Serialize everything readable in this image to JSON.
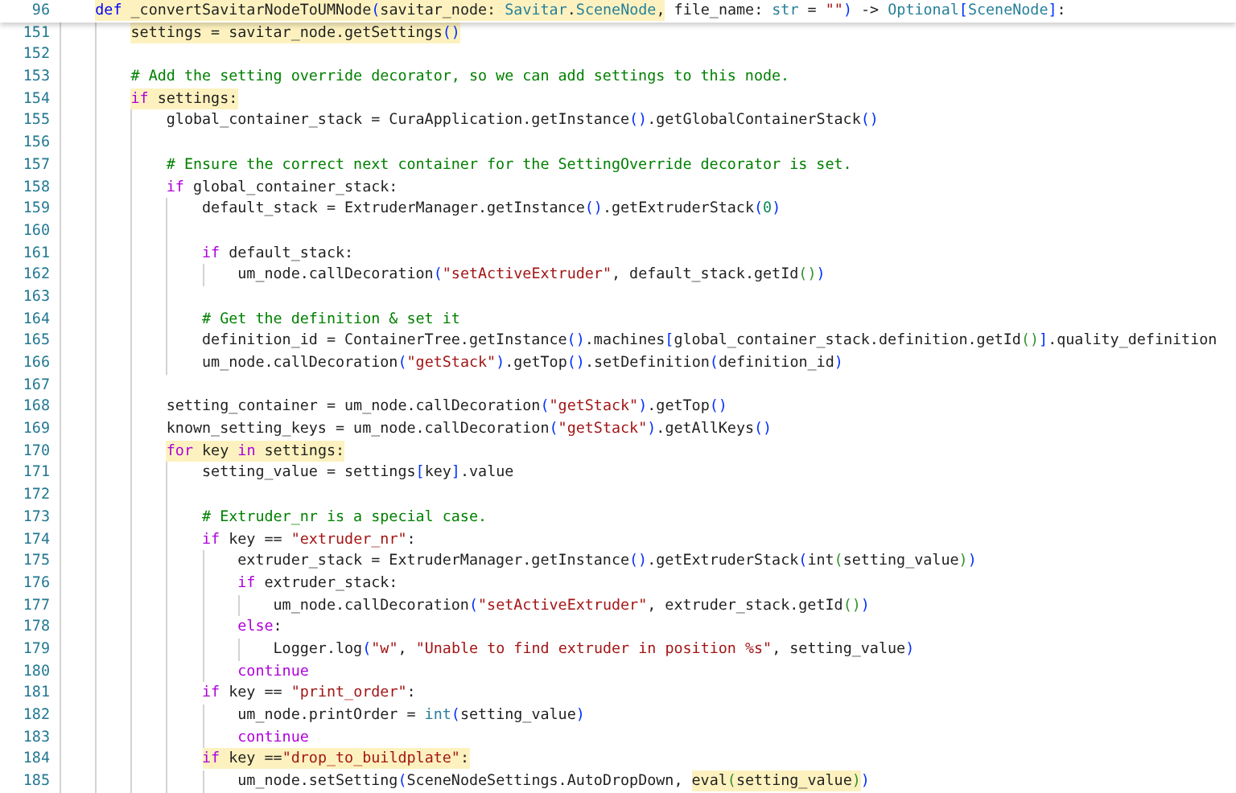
{
  "sticky_line": {
    "number": "96",
    "segments": [
      {
        "highlighted": true,
        "tokens": [
          {
            "kind": "keyword",
            "text": "def"
          },
          {
            "kind": "plain",
            "text": " _convertSavitarNodeToUMNode"
          },
          {
            "kind": "bracket",
            "text": "("
          },
          {
            "kind": "plain",
            "text": "savitar_node: "
          },
          {
            "kind": "type",
            "text": "Savitar"
          },
          {
            "kind": "plain",
            "text": "."
          },
          {
            "kind": "type",
            "text": "SceneNode"
          },
          {
            "kind": "plain",
            "text": ","
          }
        ]
      },
      {
        "highlighted": false,
        "tokens": [
          {
            "kind": "plain",
            "text": " file_name: "
          },
          {
            "kind": "type",
            "text": "str"
          },
          {
            "kind": "plain",
            "text": " = "
          },
          {
            "kind": "string",
            "text": "\"\""
          },
          {
            "kind": "bracket",
            "text": ")"
          },
          {
            "kind": "plain",
            "text": " -> "
          },
          {
            "kind": "type",
            "text": "Optional"
          },
          {
            "kind": "bracket",
            "text": "["
          },
          {
            "kind": "type",
            "text": "SceneNode"
          },
          {
            "kind": "bracket",
            "text": "]"
          },
          {
            "kind": "plain",
            "text": ":"
          }
        ]
      }
    ]
  },
  "lines": [
    {
      "number": "151",
      "segments": [
        {
          "highlighted": true,
          "tokens": [
            {
              "kind": "plain",
              "text": "settings = savitar_node.getSettings"
            },
            {
              "kind": "bracket",
              "text": "()"
            }
          ]
        }
      ]
    },
    {
      "number": "152"
    },
    {
      "number": "153",
      "segments": [
        {
          "highlighted": false,
          "tokens": [
            {
              "kind": "comment",
              "text": "# Add the setting override decorator, so we can add settings to this node."
            }
          ]
        }
      ]
    },
    {
      "number": "154",
      "segments": [
        {
          "highlighted": true,
          "tokens": [
            {
              "kind": "control",
              "text": "if"
            },
            {
              "kind": "plain",
              "text": " settings:"
            }
          ]
        }
      ],
      "children": [
        {
          "number": "155",
          "segments": [
            {
              "highlighted": false,
              "tokens": [
                {
                  "kind": "plain",
                  "text": "global_container_stack = CuraApplication.getInstance"
                },
                {
                  "kind": "bracket",
                  "text": "()"
                },
                {
                  "kind": "plain",
                  "text": ".getGlobalContainerStack"
                },
                {
                  "kind": "bracket",
                  "text": "()"
                }
              ]
            }
          ]
        },
        {
          "number": "156"
        },
        {
          "number": "157",
          "segments": [
            {
              "highlighted": false,
              "tokens": [
                {
                  "kind": "comment",
                  "text": "# Ensure the correct next container for the SettingOverride decorator is set."
                }
              ]
            }
          ]
        },
        {
          "number": "158",
          "segments": [
            {
              "highlighted": false,
              "tokens": [
                {
                  "kind": "control",
                  "text": "if"
                },
                {
                  "kind": "plain",
                  "text": " global_container_stack:"
                }
              ]
            }
          ],
          "children": [
            {
              "number": "159",
              "segments": [
                {
                  "highlighted": false,
                  "tokens": [
                    {
                      "kind": "plain",
                      "text": "default_stack = ExtruderManager.getInstance"
                    },
                    {
                      "kind": "bracket",
                      "text": "()"
                    },
                    {
                      "kind": "plain",
                      "text": ".getExtruderStack"
                    },
                    {
                      "kind": "bracket",
                      "text": "("
                    },
                    {
                      "kind": "number",
                      "text": "0"
                    },
                    {
                      "kind": "bracket",
                      "text": ")"
                    }
                  ]
                }
              ]
            },
            {
              "number": "160"
            },
            {
              "number": "161",
              "segments": [
                {
                  "highlighted": false,
                  "tokens": [
                    {
                      "kind": "control",
                      "text": "if"
                    },
                    {
                      "kind": "plain",
                      "text": " default_stack:"
                    }
                  ]
                }
              ],
              "children": [
                {
                  "number": "162",
                  "segments": [
                    {
                      "highlighted": false,
                      "tokens": [
                        {
                          "kind": "plain",
                          "text": "um_node.callDecoration"
                        },
                        {
                          "kind": "bracket",
                          "text": "("
                        },
                        {
                          "kind": "string",
                          "text": "\"setActiveExtruder\""
                        },
                        {
                          "kind": "plain",
                          "text": ", default_stack.getId"
                        },
                        {
                          "kind": "bracket2",
                          "text": "()"
                        },
                        {
                          "kind": "bracket",
                          "text": ")"
                        }
                      ]
                    }
                  ]
                }
              ]
            },
            {
              "number": "163"
            },
            {
              "number": "164",
              "segments": [
                {
                  "highlighted": false,
                  "tokens": [
                    {
                      "kind": "comment",
                      "text": "# Get the definition & set it"
                    }
                  ]
                }
              ]
            },
            {
              "number": "165",
              "segments": [
                {
                  "highlighted": false,
                  "tokens": [
                    {
                      "kind": "plain",
                      "text": "definition_id = ContainerTree.getInstance"
                    },
                    {
                      "kind": "bracket",
                      "text": "()"
                    },
                    {
                      "kind": "plain",
                      "text": ".machines"
                    },
                    {
                      "kind": "bracket",
                      "text": "["
                    },
                    {
                      "kind": "plain",
                      "text": "global_container_stack.definition.getId"
                    },
                    {
                      "kind": "bracket2",
                      "text": "()"
                    },
                    {
                      "kind": "bracket",
                      "text": "]"
                    },
                    {
                      "kind": "plain",
                      "text": ".quality_definition"
                    }
                  ]
                }
              ]
            },
            {
              "number": "166",
              "segments": [
                {
                  "highlighted": false,
                  "tokens": [
                    {
                      "kind": "plain",
                      "text": "um_node.callDecoration"
                    },
                    {
                      "kind": "bracket",
                      "text": "("
                    },
                    {
                      "kind": "string",
                      "text": "\"getStack\""
                    },
                    {
                      "kind": "bracket",
                      "text": ")"
                    },
                    {
                      "kind": "plain",
                      "text": ".getTop"
                    },
                    {
                      "kind": "bracket",
                      "text": "()"
                    },
                    {
                      "kind": "plain",
                      "text": ".setDefinition"
                    },
                    {
                      "kind": "bracket",
                      "text": "("
                    },
                    {
                      "kind": "plain",
                      "text": "definition_id"
                    },
                    {
                      "kind": "bracket",
                      "text": ")"
                    }
                  ]
                }
              ]
            }
          ]
        },
        {
          "number": "167"
        },
        {
          "number": "168",
          "segments": [
            {
              "highlighted": false,
              "tokens": [
                {
                  "kind": "plain",
                  "text": "setting_container = um_node.callDecoration"
                },
                {
                  "kind": "bracket",
                  "text": "("
                },
                {
                  "kind": "string",
                  "text": "\"getStack\""
                },
                {
                  "kind": "bracket",
                  "text": ")"
                },
                {
                  "kind": "plain",
                  "text": ".getTop"
                },
                {
                  "kind": "bracket",
                  "text": "()"
                }
              ]
            }
          ]
        },
        {
          "number": "169",
          "segments": [
            {
              "highlighted": false,
              "tokens": [
                {
                  "kind": "plain",
                  "text": "known_setting_keys = um_node.callDecoration"
                },
                {
                  "kind": "bracket",
                  "text": "("
                },
                {
                  "kind": "string",
                  "text": "\"getStack\""
                },
                {
                  "kind": "bracket",
                  "text": ")"
                },
                {
                  "kind": "plain",
                  "text": ".getAllKeys"
                },
                {
                  "kind": "bracket",
                  "text": "()"
                }
              ]
            }
          ]
        },
        {
          "number": "170",
          "segments": [
            {
              "highlighted": true,
              "tokens": [
                {
                  "kind": "control",
                  "text": "for"
                },
                {
                  "kind": "plain",
                  "text": " key "
                },
                {
                  "kind": "control",
                  "text": "in"
                },
                {
                  "kind": "plain",
                  "text": " settings:"
                }
              ]
            }
          ],
          "children": [
            {
              "number": "171",
              "segments": [
                {
                  "highlighted": false,
                  "tokens": [
                    {
                      "kind": "plain",
                      "text": "setting_value = settings"
                    },
                    {
                      "kind": "bracket",
                      "text": "["
                    },
                    {
                      "kind": "plain",
                      "text": "key"
                    },
                    {
                      "kind": "bracket",
                      "text": "]"
                    },
                    {
                      "kind": "plain",
                      "text": ".value"
                    }
                  ]
                }
              ]
            },
            {
              "number": "172"
            },
            {
              "number": "173",
              "segments": [
                {
                  "highlighted": false,
                  "tokens": [
                    {
                      "kind": "comment",
                      "text": "# Extruder_nr is a special case."
                    }
                  ]
                }
              ]
            },
            {
              "number": "174",
              "segments": [
                {
                  "highlighted": false,
                  "tokens": [
                    {
                      "kind": "control",
                      "text": "if"
                    },
                    {
                      "kind": "plain",
                      "text": " key == "
                    },
                    {
                      "kind": "string",
                      "text": "\"extruder_nr\""
                    },
                    {
                      "kind": "plain",
                      "text": ":"
                    }
                  ]
                }
              ],
              "children": [
                {
                  "number": "175",
                  "segments": [
                    {
                      "highlighted": false,
                      "tokens": [
                        {
                          "kind": "plain",
                          "text": "extruder_stack = ExtruderManager.getInstance"
                        },
                        {
                          "kind": "bracket",
                          "text": "()"
                        },
                        {
                          "kind": "plain",
                          "text": ".getExtruderStack"
                        },
                        {
                          "kind": "bracket",
                          "text": "("
                        },
                        {
                          "kind": "plain",
                          "text": "int"
                        },
                        {
                          "kind": "bracket2",
                          "text": "("
                        },
                        {
                          "kind": "plain",
                          "text": "setting_value"
                        },
                        {
                          "kind": "bracket2",
                          "text": ")"
                        },
                        {
                          "kind": "bracket",
                          "text": ")"
                        }
                      ]
                    }
                  ]
                },
                {
                  "number": "176",
                  "segments": [
                    {
                      "highlighted": false,
                      "tokens": [
                        {
                          "kind": "control",
                          "text": "if"
                        },
                        {
                          "kind": "plain",
                          "text": " extruder_stack:"
                        }
                      ]
                    }
                  ],
                  "children": [
                    {
                      "number": "177",
                      "segments": [
                        {
                          "highlighted": false,
                          "tokens": [
                            {
                              "kind": "plain",
                              "text": "um_node.callDecoration"
                            },
                            {
                              "kind": "bracket",
                              "text": "("
                            },
                            {
                              "kind": "string",
                              "text": "\"setActiveExtruder\""
                            },
                            {
                              "kind": "plain",
                              "text": ", extruder_stack.getId"
                            },
                            {
                              "kind": "bracket2",
                              "text": "()"
                            },
                            {
                              "kind": "bracket",
                              "text": ")"
                            }
                          ]
                        }
                      ]
                    }
                  ]
                },
                {
                  "number": "178",
                  "segments": [
                    {
                      "highlighted": false,
                      "tokens": [
                        {
                          "kind": "control",
                          "text": "else"
                        },
                        {
                          "kind": "plain",
                          "text": ":"
                        }
                      ]
                    }
                  ],
                  "children": [
                    {
                      "number": "179",
                      "segments": [
                        {
                          "highlighted": false,
                          "tokens": [
                            {
                              "kind": "plain",
                              "text": "Logger.log"
                            },
                            {
                              "kind": "bracket",
                              "text": "("
                            },
                            {
                              "kind": "string",
                              "text": "\"w\""
                            },
                            {
                              "kind": "plain",
                              "text": ", "
                            },
                            {
                              "kind": "string",
                              "text": "\"Unable to find extruder in position %s\""
                            },
                            {
                              "kind": "plain",
                              "text": ", setting_value"
                            },
                            {
                              "kind": "bracket",
                              "text": ")"
                            }
                          ]
                        }
                      ]
                    }
                  ]
                },
                {
                  "number": "180",
                  "segments": [
                    {
                      "highlighted": false,
                      "tokens": [
                        {
                          "kind": "control",
                          "text": "continue"
                        }
                      ]
                    }
                  ]
                }
              ]
            },
            {
              "number": "181",
              "segments": [
                {
                  "highlighted": false,
                  "tokens": [
                    {
                      "kind": "control",
                      "text": "if"
                    },
                    {
                      "kind": "plain",
                      "text": " key == "
                    },
                    {
                      "kind": "string",
                      "text": "\"print_order\""
                    },
                    {
                      "kind": "plain",
                      "text": ":"
                    }
                  ]
                }
              ],
              "children": [
                {
                  "number": "182",
                  "segments": [
                    {
                      "highlighted": false,
                      "tokens": [
                        {
                          "kind": "plain",
                          "text": "um_node.printOrder = "
                        },
                        {
                          "kind": "type",
                          "text": "int"
                        },
                        {
                          "kind": "bracket",
                          "text": "("
                        },
                        {
                          "kind": "plain",
                          "text": "setting_value"
                        },
                        {
                          "kind": "bracket",
                          "text": ")"
                        }
                      ]
                    }
                  ]
                },
                {
                  "number": "183",
                  "segments": [
                    {
                      "highlighted": false,
                      "tokens": [
                        {
                          "kind": "control",
                          "text": "continue"
                        }
                      ]
                    }
                  ]
                }
              ]
            },
            {
              "number": "184",
              "segments": [
                {
                  "highlighted": true,
                  "tokens": [
                    {
                      "kind": "control",
                      "text": "if"
                    },
                    {
                      "kind": "plain",
                      "text": " key =="
                    },
                    {
                      "kind": "string",
                      "text": "\"drop_to_buildplate\""
                    },
                    {
                      "kind": "plain",
                      "text": ":"
                    }
                  ]
                }
              ],
              "children": [
                {
                  "number": "185",
                  "segments": [
                    {
                      "highlighted": false,
                      "tokens": [
                        {
                          "kind": "plain",
                          "text": "um_node.setSetting"
                        },
                        {
                          "kind": "bracket",
                          "text": "("
                        },
                        {
                          "kind": "plain",
                          "text": "SceneNodeSettings.AutoDropDown, "
                        }
                      ]
                    },
                    {
                      "highlighted": true,
                      "tokens": [
                        {
                          "kind": "plain",
                          "text": "eval"
                        },
                        {
                          "kind": "bracket2",
                          "text": "("
                        },
                        {
                          "kind": "plain",
                          "text": "setting_value"
                        },
                        {
                          "kind": "bracket2",
                          "text": ")"
                        }
                      ]
                    },
                    {
                      "highlighted": false,
                      "tokens": [
                        {
                          "kind": "bracket",
                          "text": ")"
                        }
                      ]
                    }
                  ]
                }
              ]
            }
          ]
        }
      ]
    }
  ]
}
